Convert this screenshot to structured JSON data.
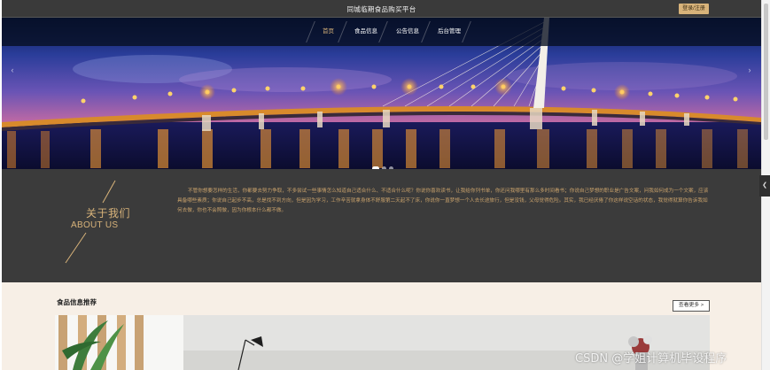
{
  "header": {
    "title": "同城临期食品购买平台",
    "login_register": "登录/注册"
  },
  "nav": {
    "items": [
      {
        "label": "首页",
        "active": true
      },
      {
        "label": "食品信息",
        "active": false
      },
      {
        "label": "公告信息",
        "active": false
      },
      {
        "label": "后台管理",
        "active": false
      }
    ]
  },
  "carousel": {
    "prev_icon": "chevron-left-icon",
    "next_icon": "chevron-right-icon",
    "slide_count": 3,
    "active_slide": 1
  },
  "about": {
    "title_cn": "关于我们",
    "title_en": "ABOUT US",
    "paragraph": "不管你想要怎样的生活，你都要去努力争取，不多尝试一些事情怎么知道自己适合什么、不适合什么呢？你说你喜欢读书，让我给你列书单，你还问我哪里有那么多时间看书；你说自己梦想的职业是广告文案，问我如何成为一个文案，应该具备哪些素质；你说自己起步不高，总是找不到方向，但是因为学习，工作辛苦就拿身体不舒服第二天起不了床，你说你一直梦想一个人去长途旅行，但是没钱，父母觉得危险。其实，我已经厌倦了你这样说空话的状态，我觉得就算你告诉我如何去做，你也不会照做，因为你根本什么都不做。"
  },
  "recommend": {
    "title": "食品信息推荐",
    "more_label": "查看更多 >"
  },
  "sidebar_tab": {
    "icon": "chevron-left-icon",
    "glyph": "❮"
  },
  "watermark": "CSDN @学姐计算机毕设程序",
  "colors": {
    "accent": "#d8b37a",
    "about_bg": "#3b3b3b",
    "recommend_bg": "#f7efe6",
    "nav_bg": "#060e20"
  }
}
